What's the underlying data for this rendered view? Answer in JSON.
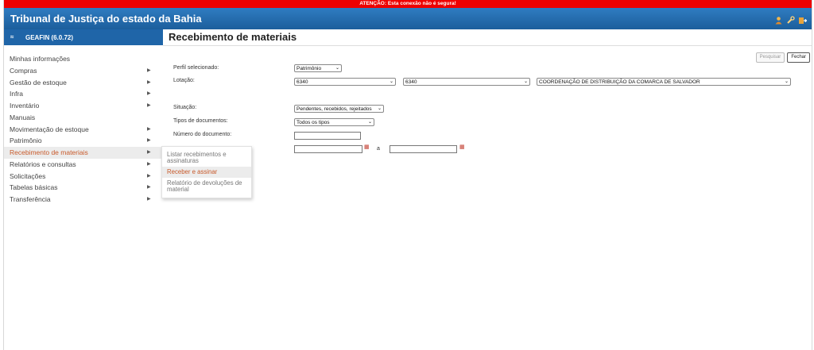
{
  "warning": "ATENÇÃO: Esta conexão não é segura!",
  "app_title": "Tribunal de Justiça do estado da Bahia",
  "system": {
    "arrow": "≈",
    "name": "GEAFIN (6.0.72)"
  },
  "page_title": "Recebimento de materiais",
  "menu": [
    {
      "label": "Minhas informações",
      "arrow": ""
    },
    {
      "label": "Compras",
      "arrow": "▶"
    },
    {
      "label": "Gestão de estoque",
      "arrow": "▶"
    },
    {
      "label": "Infra",
      "arrow": "▶"
    },
    {
      "label": "Inventário",
      "arrow": "▶"
    },
    {
      "label": "Manuais",
      "arrow": ""
    },
    {
      "label": "Movimentação de estoque",
      "arrow": "▶"
    },
    {
      "label": "Patrimônio",
      "arrow": "▶"
    },
    {
      "label": "Recebimento de materiais",
      "arrow": "▶"
    },
    {
      "label": "Relatórios e consultas",
      "arrow": "▶"
    },
    {
      "label": "Solicitações",
      "arrow": "▶"
    },
    {
      "label": "Tabelas básicas",
      "arrow": "▶"
    },
    {
      "label": "Transferência",
      "arrow": "▶"
    }
  ],
  "submenu": [
    "Listar recebimentos e assinaturas",
    "Receber e assinar",
    "Relatório de devoluções de material"
  ],
  "buttons": {
    "pesquisar": "Pesquisar",
    "fechar": "Fechar"
  },
  "form": {
    "perfil_label": "Perfil selecionado:",
    "perfil_value": "Patrimônio",
    "lotacao_label": "Lotação:",
    "lotacao_1": "6340",
    "lotacao_2": "6340",
    "lotacao_3": "COORDENAÇÃO DE DISTRIBUIÇÃO DA COMARCA DE SALVADOR",
    "situacao_label": "Situação:",
    "situacao_value": "Pendentes, recebidos, rejeitados",
    "tipos_label": "Tipos de documentos:",
    "tipos_value": "Todos os tipos",
    "numero_label": "Número do documento:",
    "date_separator": "a"
  },
  "chevron": "⌄",
  "calendar_glyph": "▦",
  "accent_color": "#c85a2b",
  "header_color": "#1f65a8"
}
